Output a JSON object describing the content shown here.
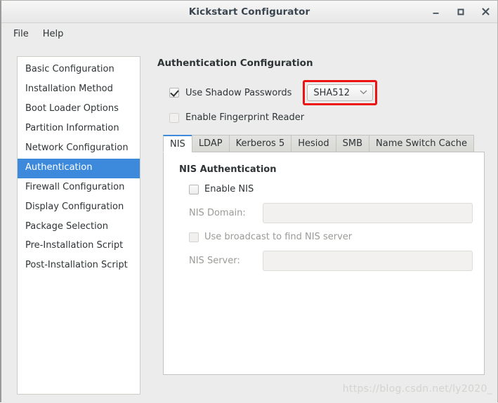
{
  "window": {
    "title": "Kickstart Configurator",
    "controls": {
      "minimize": "–",
      "maximize": "□",
      "close": "✕"
    }
  },
  "menubar": {
    "items": [
      {
        "label": "File"
      },
      {
        "label": "Help"
      }
    ]
  },
  "sidebar": {
    "items": [
      {
        "label": "Basic Configuration",
        "selected": false
      },
      {
        "label": "Installation Method",
        "selected": false
      },
      {
        "label": "Boot Loader Options",
        "selected": false
      },
      {
        "label": "Partition Information",
        "selected": false
      },
      {
        "label": "Network Configuration",
        "selected": false
      },
      {
        "label": "Authentication",
        "selected": true
      },
      {
        "label": "Firewall Configuration",
        "selected": false
      },
      {
        "label": "Display Configuration",
        "selected": false
      },
      {
        "label": "Package Selection",
        "selected": false
      },
      {
        "label": "Pre-Installation Script",
        "selected": false
      },
      {
        "label": "Post-Installation Script",
        "selected": false
      }
    ]
  },
  "pane": {
    "title": "Authentication Configuration",
    "shadow_passwords": {
      "label": "Use Shadow Passwords",
      "checked": true
    },
    "hash_algorithm": {
      "value": "SHA512",
      "chevron": "˅",
      "highlight_color": "#ee1111"
    },
    "fingerprint_reader": {
      "label": "Enable Fingerprint Reader",
      "checked": false
    },
    "tabs": [
      {
        "label": "NIS",
        "active": true
      },
      {
        "label": "LDAP",
        "active": false
      },
      {
        "label": "Kerberos 5",
        "active": false
      },
      {
        "label": "Hesiod",
        "active": false
      },
      {
        "label": "SMB",
        "active": false
      },
      {
        "label": "Name Switch Cache",
        "active": false
      }
    ],
    "nis_panel": {
      "title": "NIS Authentication",
      "enable_nis": {
        "label": "Enable NIS",
        "checked": false
      },
      "domain": {
        "label": "NIS Domain:",
        "value": "",
        "placeholder": "",
        "disabled": true
      },
      "broadcast": {
        "label": "Use broadcast to find NIS server",
        "checked": false,
        "disabled": true
      },
      "server": {
        "label": "NIS Server:",
        "value": "",
        "placeholder": "",
        "disabled": true
      }
    }
  },
  "watermark": {
    "text": "https://blog.csdn.net/ly2020_"
  },
  "colors": {
    "accent": "#3d8add",
    "highlight": "#ee1111",
    "window_bg": "#ececec",
    "panel_bg": "#ffffff"
  }
}
